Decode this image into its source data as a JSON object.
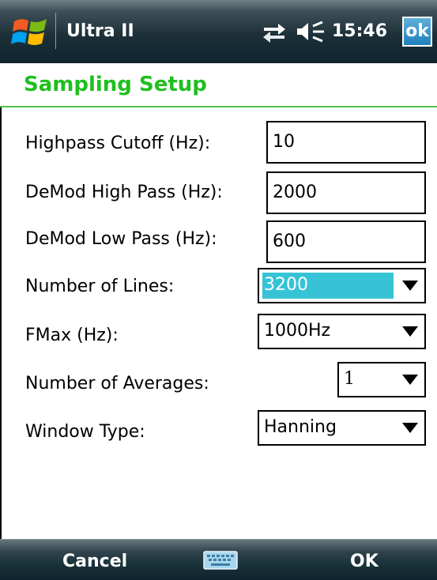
{
  "statusbar": {
    "app_title": "Ultra II",
    "time": "15:46",
    "ok_label": "ok",
    "icons": [
      "windows-start-icon",
      "connectivity-icon",
      "volume-icon"
    ]
  },
  "page": {
    "title": "Sampling Setup",
    "title_color": "#1fbf1f"
  },
  "form": {
    "highpass_cutoff": {
      "label": "Highpass Cutoff (Hz):",
      "value": "10"
    },
    "demod_high_pass": {
      "label": "DeMod High Pass (Hz):",
      "value": "2000"
    },
    "demod_low_pass": {
      "label": "DeMod Low Pass (Hz):",
      "value": "600"
    },
    "number_of_lines": {
      "label": "Number of Lines:",
      "value": "3200"
    },
    "fmax": {
      "label": "FMax (Hz):",
      "value": "1000Hz"
    },
    "number_of_averages": {
      "label": "Number of Averages:",
      "value": "1"
    },
    "window_type": {
      "label": "Window Type:",
      "value": "Hanning"
    }
  },
  "softkeys": {
    "left": "Cancel",
    "right": "OK",
    "center_icon": "keyboard-icon"
  },
  "colors": {
    "selection": "#37c3d6",
    "ok_button": "#1f80bd"
  }
}
